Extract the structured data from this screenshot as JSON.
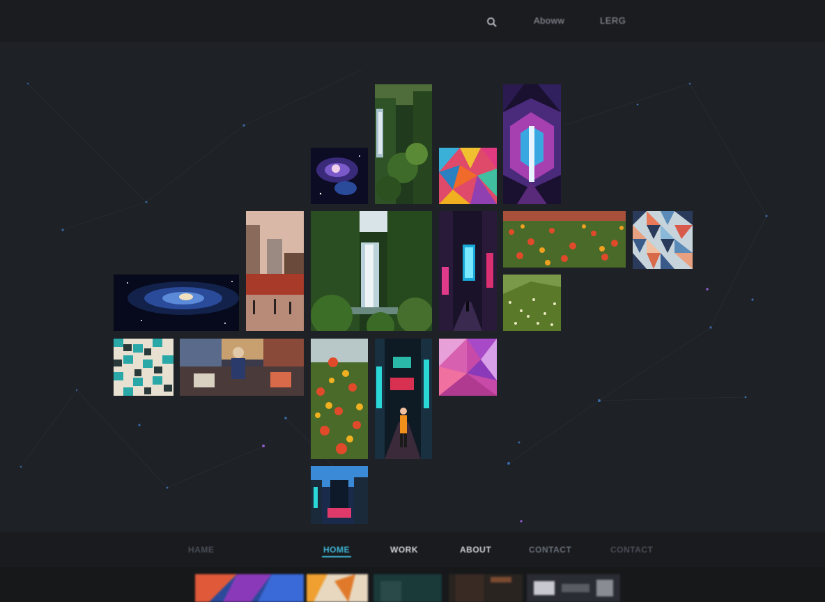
{
  "topbar": {
    "search_icon": "search-icon",
    "item_1": "Aboww",
    "item_2": "LERG"
  },
  "gallery": {
    "tiles": [
      {
        "id": "waterfall-tall",
        "subject": "waterfall jungle"
      },
      {
        "id": "neon-geometric",
        "subject": "neon geometric"
      },
      {
        "id": "galaxy-small",
        "subject": "galaxy"
      },
      {
        "id": "poly-colorful",
        "subject": "low poly"
      },
      {
        "id": "city-street",
        "subject": "city"
      },
      {
        "id": "waterfall-main",
        "subject": "waterfall"
      },
      {
        "id": "neon-alley",
        "subject": "neon alley"
      },
      {
        "id": "flower-field-wide",
        "subject": "flowers"
      },
      {
        "id": "triangle-pattern",
        "subject": "triangles"
      },
      {
        "id": "galaxy-wide",
        "subject": "spiral galaxy"
      },
      {
        "id": "green-field",
        "subject": "field"
      },
      {
        "id": "mosaic-teal",
        "subject": "mosaic"
      },
      {
        "id": "market-scene",
        "subject": "market"
      },
      {
        "id": "flower-field-tall",
        "subject": "flowers"
      },
      {
        "id": "neon-street-walker",
        "subject": "neon street"
      },
      {
        "id": "poly-pink",
        "subject": "low poly pink"
      },
      {
        "id": "city-night",
        "subject": "city night"
      }
    ]
  },
  "bottomnav": {
    "items": [
      "HAME",
      "HOME",
      "WORK",
      "ABOUT",
      "CONTACT",
      "CONTACT"
    ],
    "active_index": 1,
    "accent_color": "#3fb8d8"
  },
  "colors": {
    "background": "#1e2125",
    "bar": "#1a1c1f"
  }
}
